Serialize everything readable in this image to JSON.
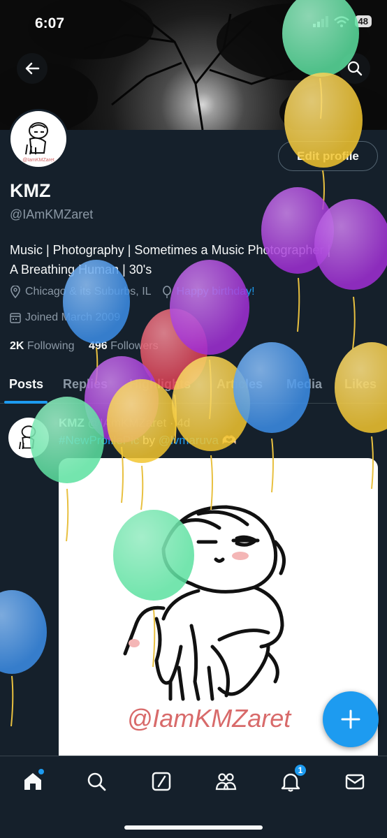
{
  "status_bar": {
    "time": "6:07",
    "battery": "48"
  },
  "profile": {
    "edit_button": "Edit profile",
    "name": "KMZ",
    "handle": "@IAmKMZaret",
    "bio_line1": "Music | Photography | Sometimes a Music Photographer |",
    "bio_line2": "A Breathing Human | 30's",
    "location": "Chicago & its Suburbs, IL",
    "birthday": "Happy birthday!",
    "joined": "Joined March 2009",
    "following_count": "2K",
    "following_label": "Following",
    "followers_count": "496",
    "followers_label": "Followers"
  },
  "tabs": [
    "Posts",
    "Replies",
    "Highlights",
    "Articles",
    "Media",
    "Likes"
  ],
  "post": {
    "author": "KMZ",
    "handle": "@IAmKMZaret",
    "separator": "·",
    "age": "4d",
    "hashtag": "#NewProfilePic",
    "by": "by",
    "mention": "@lvmaruva",
    "emoji": "🫶🏻",
    "watermark": "@IamKMZaret",
    "avatar_watermark": "@IamKMZaret"
  },
  "nav": {
    "notification_count": "1"
  },
  "colors": {
    "background": "#15202b",
    "accent": "#1d9bf0",
    "balloon_green": "#5ce0a0",
    "balloon_yellow": "#f2c62f",
    "balloon_purple": "#a12fd6",
    "balloon_blue": "#3c8ee8",
    "balloon_red": "#e83d52"
  },
  "icons": [
    "back-arrow-icon",
    "search-icon",
    "location-pin-icon",
    "balloon-icon",
    "calendar-icon",
    "plus-icon",
    "home-icon",
    "compose-icon",
    "communities-icon",
    "bell-icon",
    "mail-icon",
    "cellular-icon",
    "wifi-icon"
  ]
}
